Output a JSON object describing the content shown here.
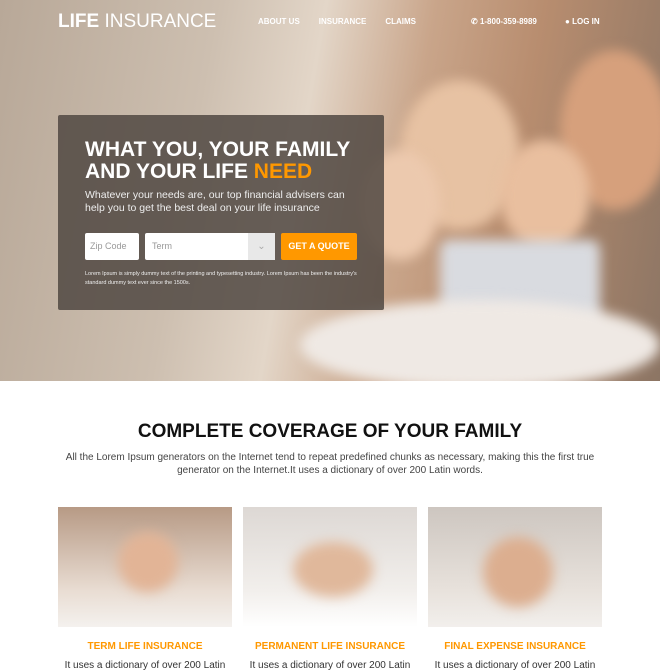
{
  "nav": {
    "logo_bold": "LIFE",
    "logo_rest": " INSURANCE",
    "links": [
      "ABOUT US",
      "INSURANCE",
      "CLAIMS"
    ],
    "phone": "1-800-359-8989",
    "login": "LOG IN"
  },
  "hero": {
    "title_line1": "WHAT YOU, YOUR FAMILY",
    "title_line2": "AND YOUR LIFE ",
    "title_highlight": "NEED",
    "subtitle": "Whatever your needs are, our top financial advisers can help you to get the best deal on your life insurance",
    "zip_placeholder": "Zip Code",
    "term_placeholder": "Term",
    "quote_button": "GET A QUOTE",
    "fine_print": "Lorem Ipsum is simply dummy text of the printing and typesetting industry. Lorem Ipsum has been the industry's standard dummy text ever since the 1500s."
  },
  "coverage": {
    "title": "COMPLETE COVERAGE OF YOUR FAMILY",
    "text": "All the Lorem Ipsum generators on the Internet tend to repeat predefined chunks as necessary, making this the first true generator on the Internet.It uses a dictionary of over 200 Latin words.",
    "cards": [
      {
        "title": "TERM LIFE INSURANCE",
        "text": "It uses a dictionary of over 200 Latin"
      },
      {
        "title": "PERMANENT LIFE INSURANCE",
        "text": "It uses a dictionary of over 200 Latin"
      },
      {
        "title": "FINAL EXPENSE INSURANCE",
        "text": "It uses a dictionary of over 200 Latin"
      }
    ]
  },
  "colors": {
    "accent": "#ff9800"
  }
}
